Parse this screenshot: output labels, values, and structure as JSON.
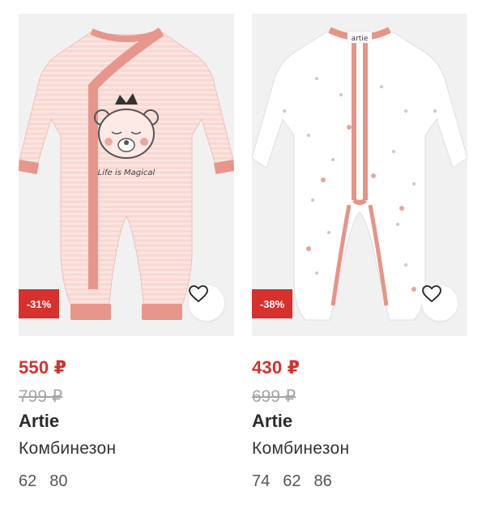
{
  "products": [
    {
      "discount": "-31%",
      "price": "550 ₽",
      "old_price": "799 ₽",
      "brand": "Artie",
      "name": "Комбинезон",
      "sizes": [
        "62",
        "80"
      ],
      "print_text": "Life is Magical",
      "body_color": "#f7d2cc",
      "trim_color": "#e7968b"
    },
    {
      "discount": "-38%",
      "price": "430 ₽",
      "old_price": "699 ₽",
      "brand": "Artie",
      "name": "Комбинезон",
      "sizes": [
        "74",
        "62",
        "86"
      ],
      "label_text": "artie",
      "body_color": "#ffffff",
      "trim_color": "#e59486"
    }
  ],
  "colors": {
    "sale": "#d6312c",
    "old_price": "#a6a6a6"
  },
  "icons": {
    "favorite": "heart-icon"
  }
}
